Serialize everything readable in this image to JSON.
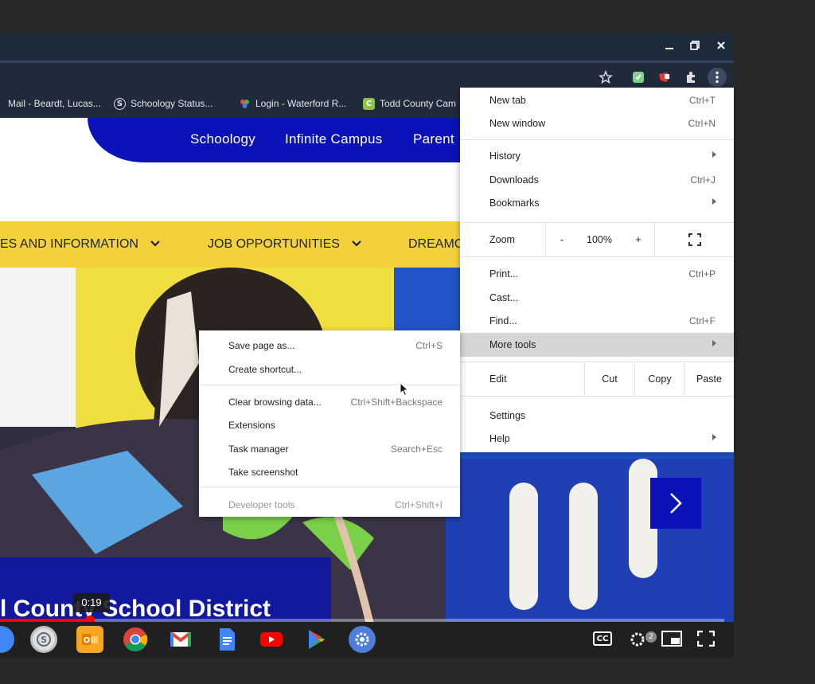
{
  "window": {
    "controls": {
      "minimize_icon": "minimize-icon",
      "restore_icon": "restore-icon",
      "close_icon": "close-icon"
    }
  },
  "bookmarks": [
    {
      "label": "Mail - Beardt, Lucas...",
      "icon": "outlook-icon"
    },
    {
      "label": "Schoology Status...",
      "icon": "schoology-icon"
    },
    {
      "label": "Login - Waterford R...",
      "icon": "waterford-icon"
    },
    {
      "label": "Todd County Cam",
      "icon": "campus-icon"
    }
  ],
  "webpage": {
    "top_nav": [
      "Schoology",
      "Infinite Campus",
      "Parent"
    ],
    "main_nav": [
      "ES AND INFORMATION",
      "JOB OPPORTUNITIES",
      "DREAMC"
    ],
    "hero_caption": "l County School District"
  },
  "chrome_menu": {
    "items_group1": [
      {
        "label": "New tab",
        "shortcut": "Ctrl+T"
      },
      {
        "label": "New window",
        "shortcut": "Ctrl+N"
      }
    ],
    "items_group2": [
      {
        "label": "History",
        "shortcut": ""
      },
      {
        "label": "Downloads",
        "shortcut": "Ctrl+J"
      },
      {
        "label": "Bookmarks",
        "shortcut": ""
      }
    ],
    "zoom": {
      "label": "Zoom",
      "minus": "-",
      "value": "100%",
      "plus": "+"
    },
    "items_group3": [
      {
        "label": "Print...",
        "shortcut": "Ctrl+P"
      },
      {
        "label": "Cast...",
        "shortcut": ""
      },
      {
        "label": "Find...",
        "shortcut": "Ctrl+F"
      },
      {
        "label": "More tools",
        "shortcut": ""
      }
    ],
    "edit": {
      "label": "Edit",
      "cut": "Cut",
      "copy": "Copy",
      "paste": "Paste"
    },
    "items_group4": [
      {
        "label": "Settings",
        "shortcut": ""
      },
      {
        "label": "Help",
        "shortcut": ""
      }
    ]
  },
  "more_tools_submenu": {
    "group1": [
      {
        "label": "Save page as...",
        "shortcut": "Ctrl+S"
      },
      {
        "label": "Create shortcut...",
        "shortcut": ""
      }
    ],
    "group2": [
      {
        "label": "Clear browsing data...",
        "shortcut": "Ctrl+Shift+Backspace"
      },
      {
        "label": "Extensions",
        "shortcut": ""
      },
      {
        "label": "Task manager",
        "shortcut": "Search+Esc"
      },
      {
        "label": "Take screenshot",
        "shortcut": ""
      }
    ],
    "group3": [
      {
        "label": "Developer tools",
        "shortcut": "Ctrl+Shift+I"
      }
    ]
  },
  "video": {
    "timestamp": "0:19",
    "progress_fraction": 0.124,
    "settings_badge": "2",
    "cc_label": "CC",
    "progress_color": "#ff0000"
  },
  "colors": {
    "site_blue": "#0a12b8",
    "site_yellow": "#f4d13b",
    "chrome_dark": "#1f2a3b",
    "menu_highlight": "#d6d6d6"
  }
}
